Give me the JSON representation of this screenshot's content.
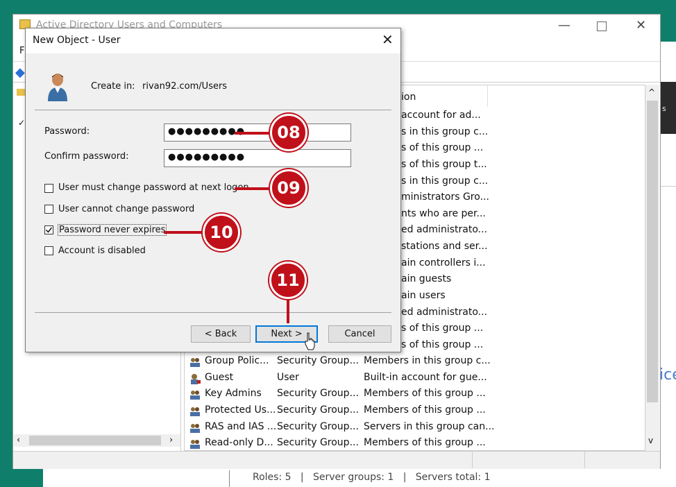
{
  "background_window": {
    "title": "Active Directory Users and Computers",
    "list_header_description": "ion",
    "descriptions_partial": [
      "account for ad...",
      "s in this group c...",
      "s of this group ...",
      "s of this group t...",
      "s in this group c...",
      "ministrators Gro...",
      "nts who are per...",
      "ed administrato...",
      "stations and ser...",
      "ain controllers i...",
      "ain guests",
      "ain users",
      "ed administrato...",
      "s of this group ...",
      "s of this group ..."
    ],
    "rows": [
      {
        "name": "Group Polic...",
        "type": "Security Group...",
        "description": "Members in this group c..."
      },
      {
        "name": "Guest",
        "type": "User",
        "description": "Built-in account for gue..."
      },
      {
        "name": "Key Admins",
        "type": "Security Group...",
        "description": "Members of this group ..."
      },
      {
        "name": "Protected Us...",
        "type": "Security Group...",
        "description": "Members of this group ..."
      },
      {
        "name": "RAS and IAS ...",
        "type": "Security Group...",
        "description": "Servers in this group can..."
      },
      {
        "name": "Read-only D...",
        "type": "Security Group...",
        "description": "Members of this group ..."
      }
    ],
    "edge_text_s": "s",
    "edge_text_ice": "ice"
  },
  "server_manager_status": "Roles: 5   |   Server groups: 1   |   Servers total: 1",
  "dialog": {
    "title": "New Object - User",
    "create_in_label": "Create in:",
    "create_in_value": "rivan92.com/Users",
    "password_label": "Password:",
    "password_value": "●●●●●●●●●",
    "confirm_label": "Confirm password:",
    "confirm_value": "●●●●●●●●●",
    "options": [
      {
        "label": "User must change password at next logon",
        "checked": false
      },
      {
        "label": "User cannot change password",
        "checked": false
      },
      {
        "label": "Password never expires",
        "checked": true
      },
      {
        "label": "Account is disabled",
        "checked": false
      }
    ],
    "back_button": "< Back",
    "next_button": "Next >",
    "cancel_button": "Cancel"
  },
  "annotations": [
    "08",
    "09",
    "10",
    "11"
  ],
  "colors": {
    "accent": "#c0101a",
    "frame": "#0f7f6b",
    "focus": "#0078d7"
  }
}
